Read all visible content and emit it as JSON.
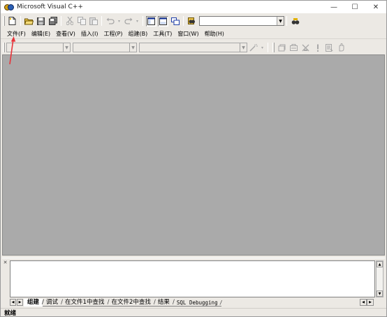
{
  "window": {
    "title": "Microsoft Visual C++",
    "controls": {
      "minimize": "—",
      "maximize": "☐",
      "close": "✕"
    }
  },
  "menu": {
    "items": [
      {
        "label": "文件(F)"
      },
      {
        "label": "编辑(E)"
      },
      {
        "label": "查看(V)"
      },
      {
        "label": "插入(I)"
      },
      {
        "label": "工程(P)"
      },
      {
        "label": "组建(B)"
      },
      {
        "label": "工具(T)"
      },
      {
        "label": "窗口(W)"
      },
      {
        "label": "帮助(H)"
      }
    ]
  },
  "toolbar_standard": {
    "icons": [
      "new-file-icon",
      "open-folder-icon",
      "save-icon",
      "save-all-icon",
      "cut-icon",
      "copy-icon",
      "paste-icon",
      "undo-icon",
      "redo-icon",
      "workspace-icon",
      "output-icon",
      "window-list-icon",
      "find-in-files-icon",
      "find-icon"
    ],
    "find_combo_value": ""
  },
  "toolbar_wizard": {
    "class_combo_value": "",
    "filter_combo_value": "",
    "members_combo_value": ""
  },
  "output": {
    "tabs": [
      {
        "label": "组建",
        "active": true
      },
      {
        "label": "调试",
        "active": false
      },
      {
        "label": "在文件1中查找",
        "active": false
      },
      {
        "label": "在文件2中查找",
        "active": false
      },
      {
        "label": "结果",
        "active": false
      },
      {
        "label": "SQL Debugging",
        "active": false
      }
    ]
  },
  "statusbar": {
    "text": "就绪"
  },
  "annotation": {
    "color": "#e8343a",
    "points_to": "menu-item-file"
  },
  "colors": {
    "frame": "#ece9e4",
    "workspace": "#aaaaaa",
    "arrow": "#e8343a"
  }
}
